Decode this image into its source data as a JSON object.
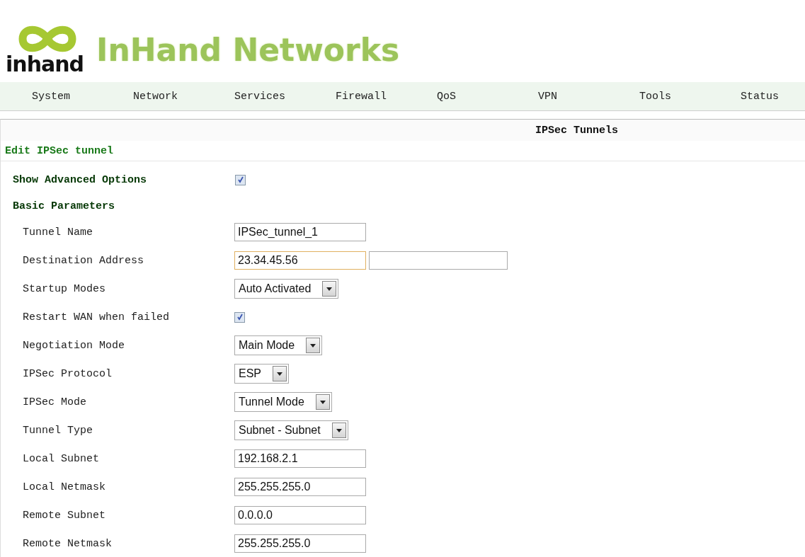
{
  "logo": {
    "wordmark": "inhand",
    "brand": "InHand Networks"
  },
  "nav": [
    {
      "label": "System"
    },
    {
      "label": "Network"
    },
    {
      "label": "Services"
    },
    {
      "label": "Firewall"
    },
    {
      "label": "QoS"
    },
    {
      "label": "VPN"
    },
    {
      "label": "Tools"
    },
    {
      "label": "Status"
    }
  ],
  "page_title": "IPSec Tunnels",
  "section_title": "Edit IPSec tunnel",
  "advanced": {
    "label": "Show Advanced Options",
    "checked": true
  },
  "group_title": "Basic Parameters",
  "fields": [
    {
      "kind": "text",
      "label": "Tunnel Name",
      "value": "IPSec_tunnel_1"
    },
    {
      "kind": "text_pair",
      "label": "Destination Address",
      "value": "23.34.45.56",
      "focused": true
    },
    {
      "kind": "select",
      "label": "Startup Modes",
      "value": "Auto Activated"
    },
    {
      "kind": "checkbox",
      "label": "Restart WAN when failed",
      "checked": true
    },
    {
      "kind": "select",
      "label": "Negotiation Mode",
      "value": "Main Mode"
    },
    {
      "kind": "select",
      "label": "IPSec Protocol",
      "value": "ESP"
    },
    {
      "kind": "select",
      "label": "IPSec Mode",
      "value": "Tunnel Mode"
    },
    {
      "kind": "select",
      "label": "Tunnel Type",
      "value": "Subnet - Subnet"
    },
    {
      "kind": "text",
      "label": "Local Subnet",
      "value": "192.168.2.1"
    },
    {
      "kind": "text",
      "label": "Local Netmask",
      "value": "255.255.255.0"
    },
    {
      "kind": "text",
      "label": "Remote Subnet",
      "value": "0.0.0.0"
    },
    {
      "kind": "text",
      "label": "Remote Netmask",
      "value": "255.255.255.0"
    }
  ]
}
